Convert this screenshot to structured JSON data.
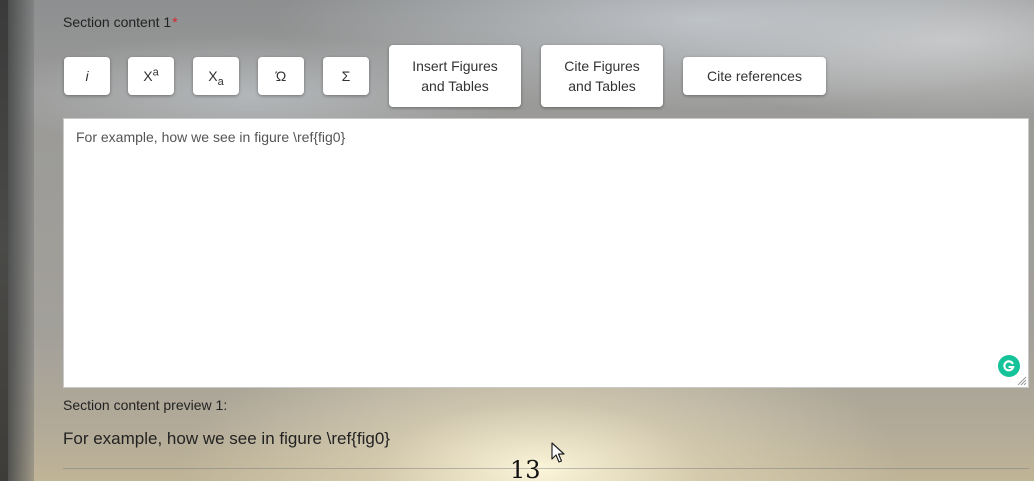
{
  "section": {
    "label": "Section content 1",
    "required_marker": "*"
  },
  "toolbar": {
    "italic_label": "i",
    "superscript_base": "X",
    "superscript_sup": "a",
    "subscript_base": "X",
    "subscript_sub": "a",
    "special_chars_label": "Ώ",
    "math_label": "Σ",
    "insert_figures_line1": "Insert Figures",
    "insert_figures_line2": "and Tables",
    "cite_figures_line1": "Cite Figures",
    "cite_figures_line2": "and Tables",
    "cite_references_label": "Cite references"
  },
  "editor": {
    "content": "For example, how we see in figure \\ref{fig0}",
    "grammarly_icon": "grammarly-icon"
  },
  "preview": {
    "label": "Section content preview 1:",
    "text": "For example, how we see in figure \\ref{fig0}"
  },
  "page_number": "13",
  "colors": {
    "required": "#d9272e",
    "grammarly": "#15c39a",
    "button_bg": "#ffffff"
  }
}
